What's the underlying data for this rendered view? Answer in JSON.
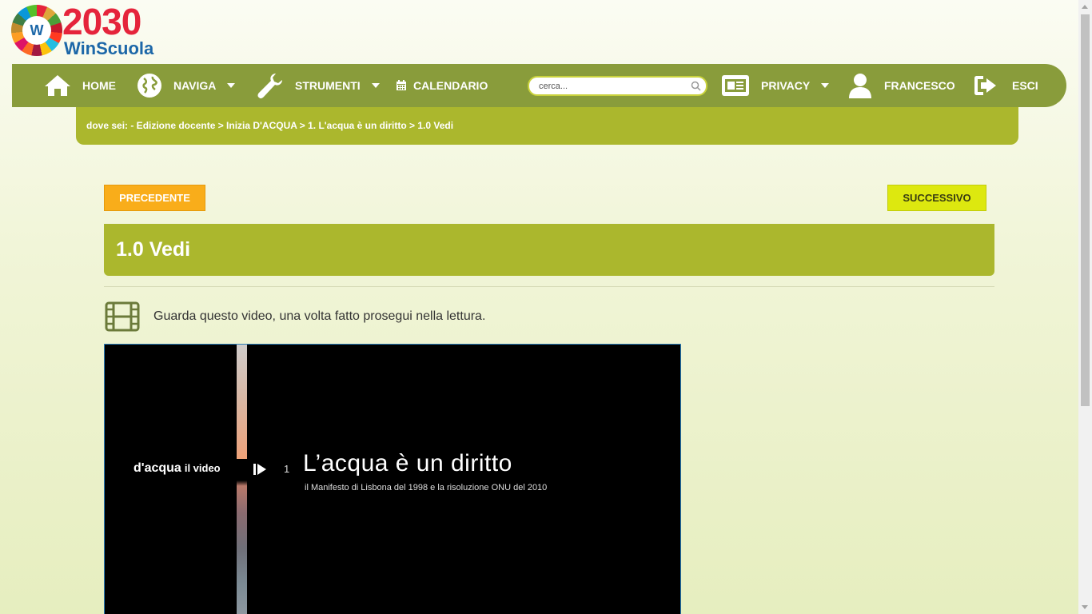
{
  "logo": {
    "year": "2030",
    "brand": "WinScuola",
    "badge_letter": "W"
  },
  "nav": {
    "home": "HOME",
    "naviga": "NAVIGA",
    "strumenti": "STRUMENTI",
    "calendario": "CALENDARIO",
    "search_placeholder": "cerca...",
    "privacy": "PRIVACY",
    "user": "FRANCESCO",
    "esci": "ESCI"
  },
  "breadcrumb": {
    "prefix": "dove sei: - Edizione docente > Inizia D'ACQUA > 1. L'acqua è un diritto > ",
    "current": "1.0 Vedi"
  },
  "buttons": {
    "prev": "PRECEDENTE",
    "next": "SUCCESSIVO"
  },
  "page": {
    "title": "1.0 Vedi",
    "intro": "Guarda questo video, una volta fatto prosegui nella lettura."
  },
  "video": {
    "brand": "d'acqua",
    "brand_suffix": "il video",
    "number": "1",
    "title": "L’acqua è un diritto",
    "subtitle": "il Manifesto di Lisbona del 1998 e la risoluzione ONU del 2010"
  },
  "colors": {
    "navbar": "#899c3b",
    "breadcrumb": "#abb72d",
    "prev_button": "#f9ad1a",
    "next_button": "#dde80f"
  }
}
